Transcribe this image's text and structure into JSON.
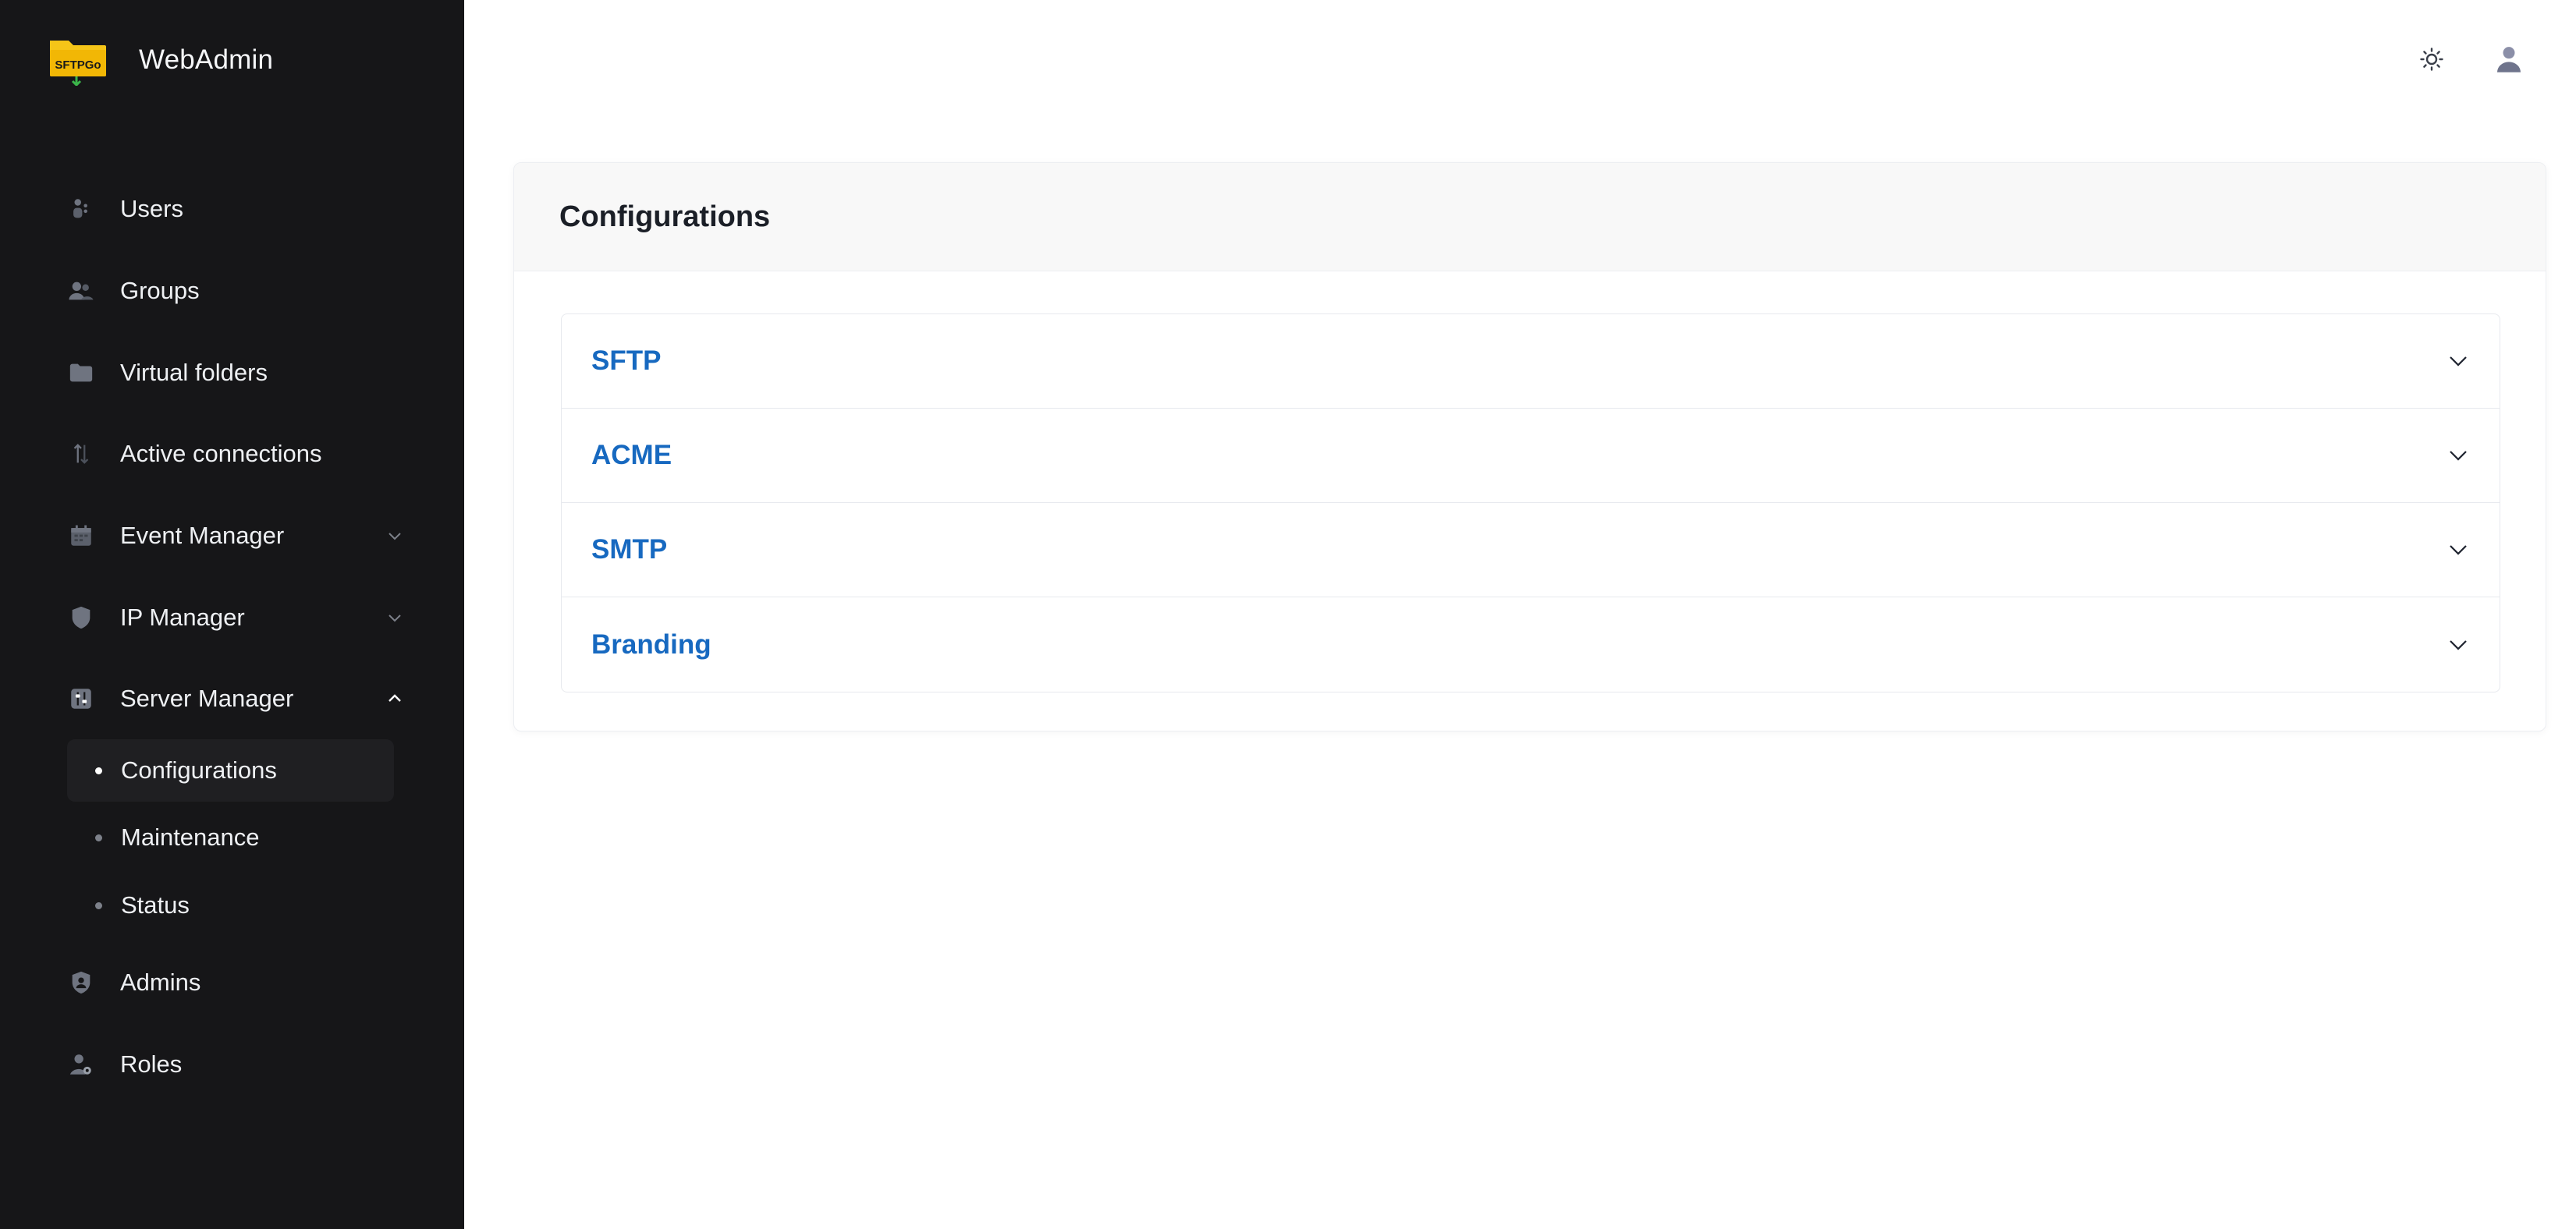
{
  "app": {
    "title": "WebAdmin",
    "logo_text": "SFTPGo"
  },
  "sidebar": {
    "items": [
      {
        "label": "Users",
        "icon": "users-icon"
      },
      {
        "label": "Groups",
        "icon": "groups-icon"
      },
      {
        "label": "Virtual folders",
        "icon": "folder-icon"
      },
      {
        "label": "Active connections",
        "icon": "connections-icon"
      },
      {
        "label": "Event Manager",
        "icon": "calendar-icon",
        "expandable": true,
        "expanded": false
      },
      {
        "label": "IP Manager",
        "icon": "shield-icon",
        "expandable": true,
        "expanded": false
      },
      {
        "label": "Server Manager",
        "icon": "sliders-icon",
        "expandable": true,
        "expanded": true
      },
      {
        "label": "Admins",
        "icon": "admin-shield-icon"
      },
      {
        "label": "Roles",
        "icon": "user-gear-icon"
      }
    ],
    "server_manager_sub": [
      {
        "label": "Configurations",
        "active": true
      },
      {
        "label": "Maintenance",
        "active": false
      },
      {
        "label": "Status",
        "active": false
      }
    ]
  },
  "header": {
    "theme_icon": "sun-icon",
    "user_icon": "user-icon"
  },
  "main": {
    "card_title": "Configurations",
    "sections": [
      {
        "label": "SFTP"
      },
      {
        "label": "ACME"
      },
      {
        "label": "SMTP"
      },
      {
        "label": "Branding"
      }
    ]
  },
  "colors": {
    "sidebar_bg": "#161618",
    "accent_link": "#1769c0",
    "logo_yellow": "#f5c518"
  }
}
